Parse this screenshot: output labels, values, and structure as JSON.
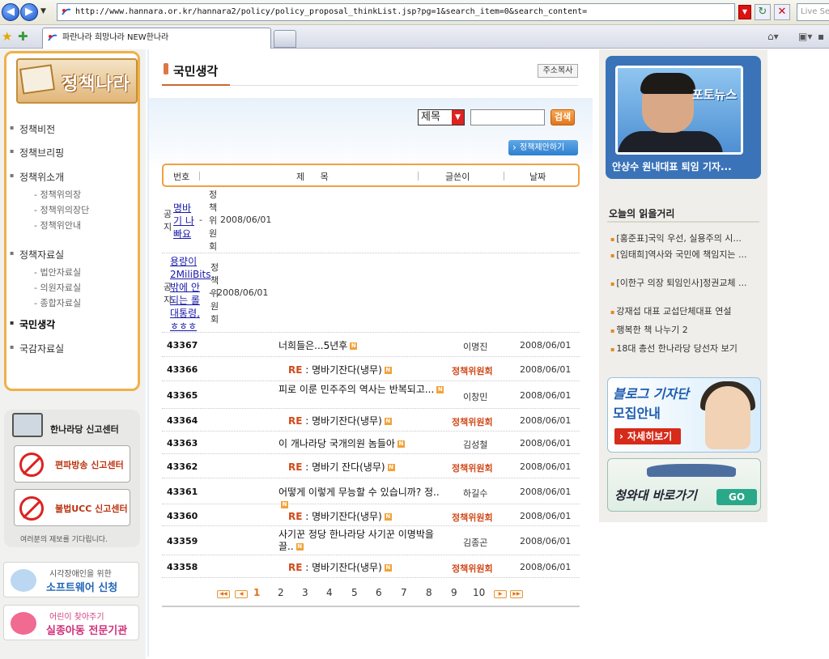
{
  "browser": {
    "url": "http://www.hannara.or.kr/hannara2/policy/policy_proposal_thinkList.jsp?pg=1&search_item=0&search_content=",
    "tab_title": "파란나라 희망나라 NEW한나라",
    "live_search_placeholder": "Live Se"
  },
  "logo": {
    "text": "정책나라"
  },
  "menu": {
    "items": [
      {
        "label": "정책비전"
      },
      {
        "label": "정책브리핑"
      },
      {
        "label": "정책위소개",
        "sub": [
          "- 정책위의장",
          "- 정책위의장단",
          "- 정책위안내"
        ]
      },
      {
        "label": "정책자료실",
        "sub": [
          "- 법안자료실",
          "- 의원자료실",
          "- 종합자료실"
        ]
      },
      {
        "label": "국민생각"
      },
      {
        "label": "국감자료실"
      }
    ]
  },
  "report_center": {
    "title": "한나라당 신고센터",
    "btn1": "편파방송 신고센터",
    "btn2": "불법UCC 신고센터",
    "note": "여러분의 제보를 기다립니다."
  },
  "banners": {
    "software_small": "시각장애인을 위한",
    "software_big": "소프트웨어 신청",
    "child_small": "어린이 찾아주기",
    "child_big": "실종아동 전문기관"
  },
  "main": {
    "title": "국민생각",
    "copy_url": "주소복사",
    "search_select": "제목",
    "search_btn": "검색",
    "propose_btn": "정책제안하기",
    "headers": {
      "num": "번호",
      "subject": "제 목",
      "author": "글쓴이",
      "date": "날짜"
    },
    "notices": [
      {
        "label": "공\n지",
        "link": "명바\n기 나\n빠요",
        "dash": "-",
        "author": "정\n책\n위\n원\n회",
        "date": "2008/06/01"
      },
      {
        "label": "공\n지",
        "link": "용량이\n2MiliBits\n밖에 안\n되는 롤\n대통령,\nㅎㅎㅎ",
        "dash": "-",
        "author": "정\n책\n위\n원\n회",
        "date": "2008/06/01"
      }
    ],
    "rows": [
      {
        "num": "43367",
        "re": "",
        "subject": "너희들은...5년후",
        "author": "이명진",
        "date": "2008/06/01"
      },
      {
        "num": "43366",
        "re": "RE",
        "subject": " : 명바기잔다(냉무)",
        "author": "정책위원회",
        "date": "2008/06/01"
      },
      {
        "num": "43365",
        "re": "",
        "subject": "피로 이룬 민주주의 역사는 반복되고...",
        "author": "이창민",
        "date": "2008/06/01"
      },
      {
        "num": "43364",
        "re": "RE",
        "subject": " : 명바기잔다(냉무)",
        "author": "정책위원회",
        "date": "2008/06/01"
      },
      {
        "num": "43363",
        "re": "",
        "subject": "이 개나라당 국개의원 놈들아",
        "author": "김성철",
        "date": "2008/06/01"
      },
      {
        "num": "43362",
        "re": "RE",
        "subject": " : 명바기 잔다(냉무)",
        "author": "정책위원회",
        "date": "2008/06/01"
      },
      {
        "num": "43361",
        "re": "",
        "subject": "어떻게 이렇게 무능할 수 있습니까? 정..",
        "author": "하길수",
        "date": "2008/06/01"
      },
      {
        "num": "43360",
        "re": "RE",
        "subject": " : 명바기잔다(냉무)",
        "author": "정책위원회",
        "date": "2008/06/01"
      },
      {
        "num": "43359",
        "re": "",
        "subject": "사기꾼 정당 한나라당 사기꾼 이명박을 끌..",
        "author": "김종곤",
        "date": "2008/06/01"
      },
      {
        "num": "43358",
        "re": "RE",
        "subject": " : 명바기잔다(냉무)",
        "author": "정책위원회",
        "date": "2008/06/01"
      }
    ],
    "new_mark": "N",
    "pages": [
      "1",
      "2",
      "3",
      "4",
      "5",
      "6",
      "7",
      "8",
      "9",
      "10"
    ],
    "current_page": "1"
  },
  "right": {
    "photo_tag": "포토뉴스",
    "photo_caption": "안상수 원내대표 퇴임 기자...",
    "reading_title": "오늘의 읽을거리",
    "reading": [
      "[홍준표]국익 우선, 실용주의 시...",
      "[임태희]역사와 국민에 책임지는 ...",
      "[이한구 의장 퇴임인사]정권교체 ...",
      "강재섭 대표 교섭단체대표 연설",
      "행복한 책 나누기 2",
      "18대 총선 한나라당 당선자 보기"
    ],
    "blog_t1": "블로그 기자단",
    "blog_t2": "모집안내",
    "blog_btn": "자세히보기",
    "bh_text": "청와대 바로가기",
    "bh_go": "GO"
  }
}
